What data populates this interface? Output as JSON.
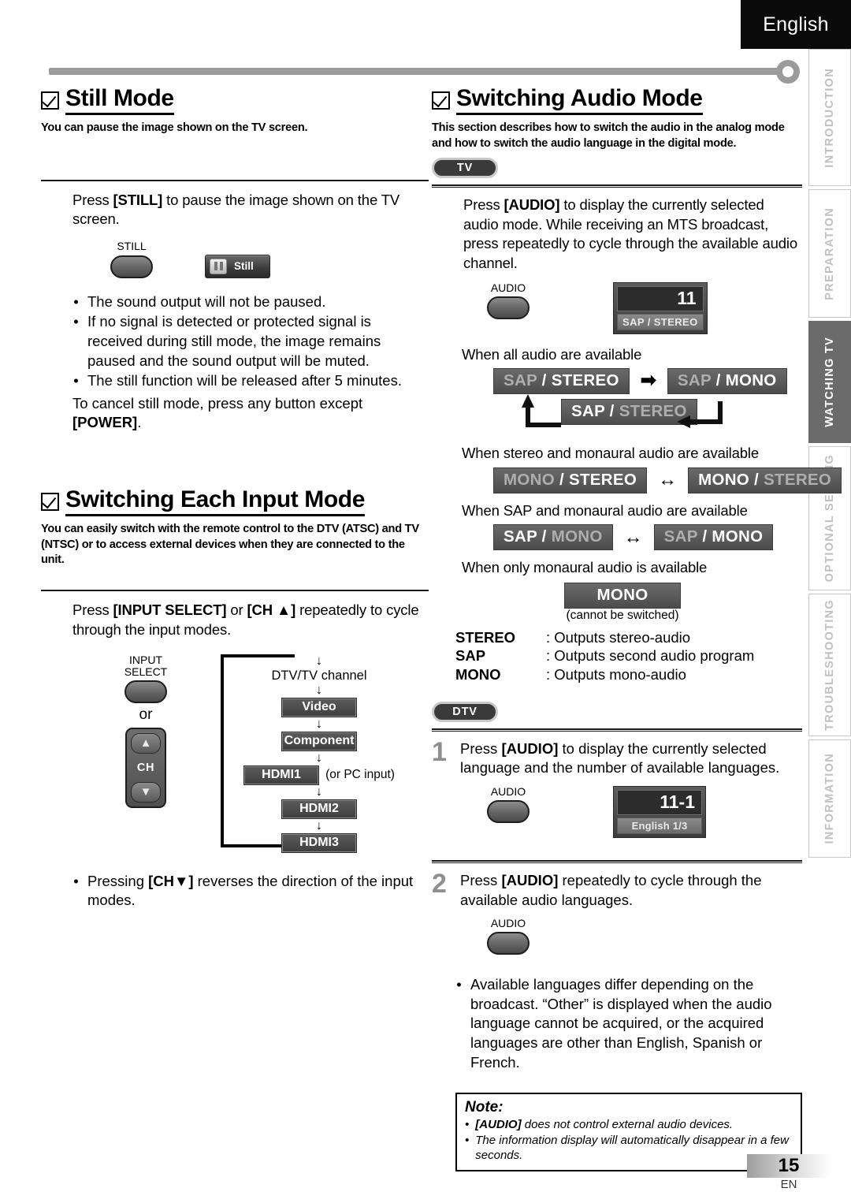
{
  "header": {
    "language": "English"
  },
  "index_tabs": [
    {
      "label": "INTRODUCTION",
      "active": false
    },
    {
      "label": "PREPARATION",
      "active": false
    },
    {
      "label": "WATCHING TV",
      "active": true
    },
    {
      "label": "OPTIONAL  SETTING",
      "active": false
    },
    {
      "label": "TROUBLESHOOTING",
      "active": false
    },
    {
      "label": "INFORMATION",
      "active": false
    }
  ],
  "still_mode": {
    "title": "Still Mode",
    "subtitle": "You can pause the image shown on the TV screen.",
    "instruction_pre": "Press ",
    "instruction_key": "[STILL]",
    "instruction_post": " to pause the image shown on the TV screen.",
    "button_label": "STILL",
    "osd_label": "Still",
    "bullets": [
      "The sound output will not be paused.",
      "If no signal is detected or protected signal is received during still mode, the image remains paused and the sound output will be muted.",
      "The still function will be released after 5 minutes."
    ],
    "cancel_pre": "To cancel still mode, press any button except ",
    "cancel_key": "[POWER]",
    "cancel_post": "."
  },
  "input_mode": {
    "title": "Switching Each Input Mode",
    "subtitle": "You can easily switch with the remote control to the DTV (ATSC) and TV (NTSC) or to access external devices when they are connected to the unit.",
    "instruction_pre": "Press ",
    "instruction_key1": "[INPUT SELECT]",
    "instruction_mid": " or ",
    "instruction_key2": "[CH ▲]",
    "instruction_post": " repeatedly to cycle through the input modes.",
    "button_label_line1": "INPUT",
    "button_label_line2": "SELECT",
    "or_label": "or",
    "ch_label": "CH",
    "flow_top": "DTV/TV channel",
    "flow_items": [
      "Video",
      "Component",
      "HDMI1",
      "HDMI2",
      "HDMI3"
    ],
    "flow_side_note": "(or PC input)",
    "bullet_pre": "Pressing ",
    "bullet_key": "[CH▼]",
    "bullet_post": " reverses the direction of the input modes."
  },
  "audio_mode": {
    "title": "Switching Audio Mode",
    "subtitle": "This section describes how to switch the audio in the analog mode and how to switch the audio language in the digital mode.",
    "tv_badge": "TV",
    "dtv_badge": "DTV",
    "tv_instruction_pre": "Press ",
    "tv_instruction_key": "[AUDIO]",
    "tv_instruction_post": " to display the currently selected audio mode. While receiving an MTS broadcast, press repeatedly to cycle through the available audio channel.",
    "audio_button_label": "AUDIO",
    "osd_channel": "11",
    "osd_caption": "SAP / STEREO",
    "case1_label": "When all audio are available",
    "case1_chips": [
      {
        "left": "SAP",
        "left_on": false,
        "right": "STEREO",
        "right_on": true
      },
      {
        "left": "SAP",
        "left_on": false,
        "right": "MONO",
        "right_on": true
      },
      {
        "left": "SAP",
        "left_on": true,
        "right": "STEREO",
        "right_on": false
      }
    ],
    "case2_label": "When stereo and monaural audio are available",
    "case2_chips": [
      {
        "left": "MONO",
        "left_on": false,
        "right": "STEREO",
        "right_on": true
      },
      {
        "left": "MONO",
        "left_on": true,
        "right": "STEREO",
        "right_on": false
      }
    ],
    "case3_label": "When SAP and monaural audio are available",
    "case3_chips": [
      {
        "left": "SAP",
        "left_on": true,
        "right": "MONO",
        "right_on": false
      },
      {
        "left": "SAP",
        "left_on": false,
        "right": "MONO",
        "right_on": true
      }
    ],
    "case4_label": "When only monaural audio is available",
    "case4_chip": "MONO",
    "case4_note": "(cannot be switched)",
    "legend": [
      {
        "key": "STEREO",
        "value": ": Outputs stereo-audio"
      },
      {
        "key": "SAP",
        "value": ": Outputs second audio program"
      },
      {
        "key": "MONO",
        "value": ": Outputs mono-audio"
      }
    ],
    "step1_num": "1",
    "step1_pre": "Press ",
    "step1_key": "[AUDIO]",
    "step1_post": " to display the currently selected language and the number of available languages.",
    "step1_osd_channel": "11-1",
    "step1_osd_caption": "English 1/3",
    "step2_num": "2",
    "step2_pre": "Press ",
    "step2_key": "[AUDIO]",
    "step2_post": " repeatedly to cycle through the available audio languages.",
    "dtv_bullet": "Available languages differ depending on the broadcast. “Other” is displayed when the audio language cannot be acquired, or the acquired languages are other than English, Spanish or French.",
    "note_title": "Note:",
    "note_items": [
      {
        "key": "[AUDIO]",
        "text": " does not control external audio devices."
      },
      {
        "key": "",
        "text": "The information display will automatically disappear in a few seconds."
      }
    ]
  },
  "footer": {
    "page_number": "15",
    "lang_code": "EN"
  },
  "arrows": {
    "right": "➡",
    "both": "↔",
    "down": "↓"
  }
}
